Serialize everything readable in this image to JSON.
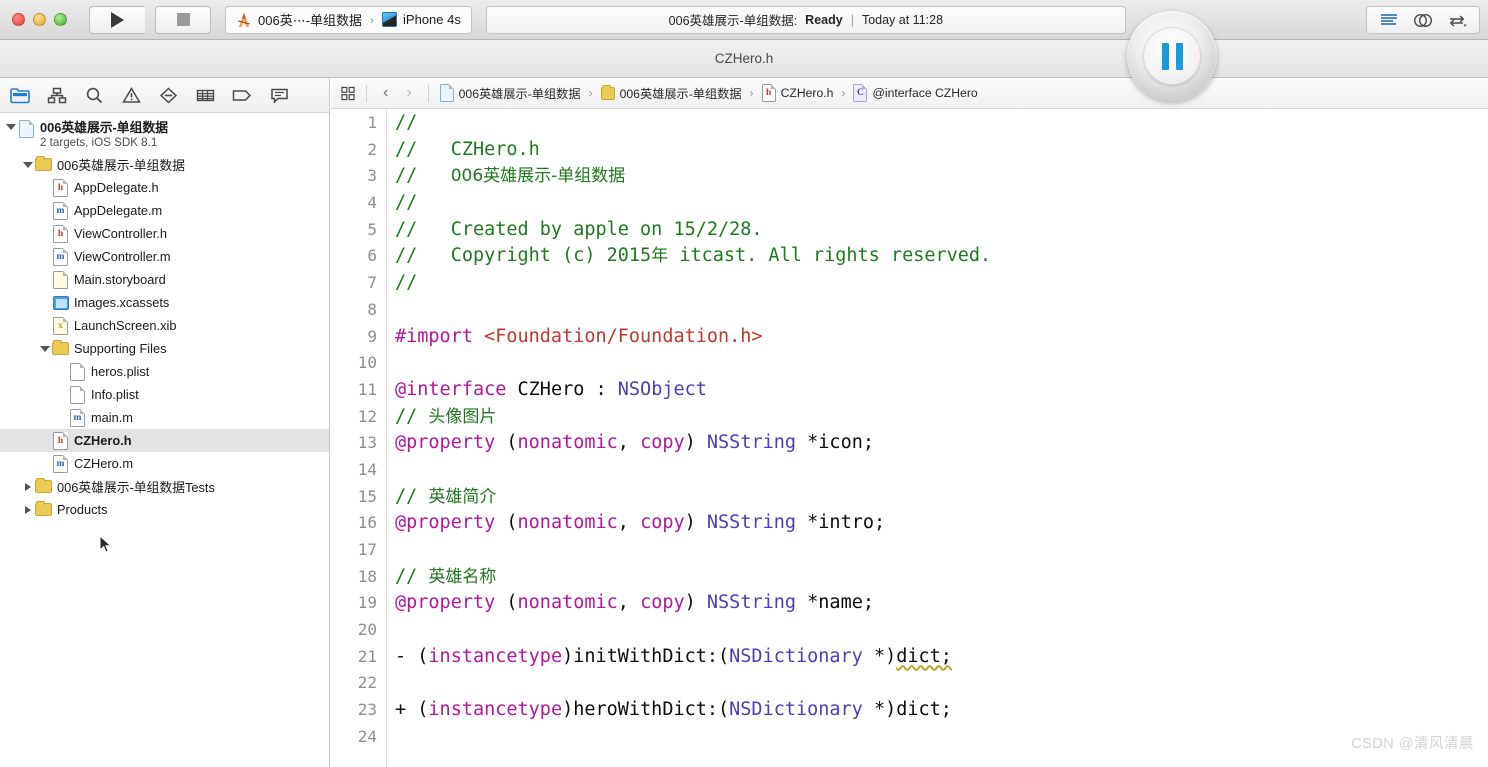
{
  "window": {
    "title": "CZHero.h"
  },
  "toolbar": {
    "run_label": "Run",
    "stop_label": "Stop",
    "scheme": {
      "project": "006英⋯-单组数据",
      "separator": "›",
      "destination": "iPhone 4s"
    },
    "status": {
      "target": "006英雄展示-单组数据:",
      "state": "Ready",
      "divider": "|",
      "time": "Today at 11:28"
    },
    "right_icons": [
      "editor-standard-icon",
      "editor-assistant-icon",
      "editor-version-icon"
    ]
  },
  "navigator": {
    "toolbar_icons": [
      "project-navigator-icon",
      "symbol-navigator-icon",
      "find-navigator-icon",
      "issue-navigator-icon",
      "test-navigator-icon",
      "debug-navigator-icon",
      "breakpoint-navigator-icon",
      "report-navigator-icon"
    ],
    "tree": [
      {
        "label": "006英雄展示-单组数据",
        "sub": "2 targets, iOS SDK 8.1",
        "icon": "project-file-icon",
        "indent": 0,
        "disclosure": "open",
        "type": "project",
        "selected": false
      },
      {
        "label": "006英雄展示-单组数据",
        "icon": "folder-icon",
        "indent": 1,
        "disclosure": "open",
        "type": "group",
        "selected": false
      },
      {
        "label": "AppDelegate.h",
        "icon": "header-file-icon",
        "indent": 2,
        "disclosure": "none",
        "type": "file",
        "selected": false
      },
      {
        "label": "AppDelegate.m",
        "icon": "source-file-icon",
        "indent": 2,
        "disclosure": "none",
        "type": "file",
        "selected": false
      },
      {
        "label": "ViewController.h",
        "icon": "header-file-icon",
        "indent": 2,
        "disclosure": "none",
        "type": "file",
        "selected": false
      },
      {
        "label": "ViewController.m",
        "icon": "source-file-icon",
        "indent": 2,
        "disclosure": "none",
        "type": "file",
        "selected": false
      },
      {
        "label": "Main.storyboard",
        "icon": "storyboard-file-icon",
        "indent": 2,
        "disclosure": "none",
        "type": "file",
        "selected": false
      },
      {
        "label": "Images.xcassets",
        "icon": "asset-catalog-icon",
        "indent": 2,
        "disclosure": "none",
        "type": "file",
        "selected": false
      },
      {
        "label": "LaunchScreen.xib",
        "icon": "xib-file-icon",
        "indent": 2,
        "disclosure": "none",
        "type": "file",
        "selected": false
      },
      {
        "label": "Supporting Files",
        "icon": "folder-icon",
        "indent": 2,
        "disclosure": "open",
        "type": "group",
        "selected": false
      },
      {
        "label": "heros.plist",
        "icon": "plist-file-icon",
        "indent": 3,
        "disclosure": "none",
        "type": "file",
        "selected": false
      },
      {
        "label": "Info.plist",
        "icon": "plist-file-icon",
        "indent": 3,
        "disclosure": "none",
        "type": "file",
        "selected": false
      },
      {
        "label": "main.m",
        "icon": "source-file-icon",
        "indent": 3,
        "disclosure": "none",
        "type": "file",
        "selected": false
      },
      {
        "label": "CZHero.h",
        "icon": "header-file-icon",
        "indent": 2,
        "disclosure": "none",
        "type": "file",
        "selected": true
      },
      {
        "label": "CZHero.m",
        "icon": "source-file-icon",
        "indent": 2,
        "disclosure": "none",
        "type": "file",
        "selected": false
      },
      {
        "label": "006英雄展示-单组数据Tests",
        "icon": "folder-icon",
        "indent": 1,
        "disclosure": "closed",
        "type": "group",
        "selected": false
      },
      {
        "label": "Products",
        "icon": "folder-icon",
        "indent": 1,
        "disclosure": "closed",
        "type": "group",
        "selected": false
      }
    ]
  },
  "editor": {
    "jumpbar": {
      "related_items_icon": "related-items-icon",
      "back_label": "‹",
      "forward_label": "›",
      "breadcrumbs": [
        {
          "label": "006英雄展示-单组数据",
          "icon": "project-file-icon"
        },
        {
          "label": "006英雄展示-单组数据",
          "icon": "folder-icon"
        },
        {
          "label": "CZHero.h",
          "icon": "header-file-icon"
        },
        {
          "label": "@interface CZHero",
          "icon": "class-symbol-icon"
        }
      ],
      "separator": "›"
    },
    "filename": "CZHero.h",
    "language": "objective-c",
    "first_line": 1,
    "lines": [
      {
        "n": 1,
        "tokens": [
          {
            "t": "//",
            "c": "cmt"
          }
        ]
      },
      {
        "n": 2,
        "tokens": [
          {
            "t": "//   CZHero.h",
            "c": "cmt"
          }
        ]
      },
      {
        "n": 3,
        "tokens": [
          {
            "t": "//   ",
            "c": "cmt"
          },
          {
            "t": "006英雄展示-单组数据",
            "c": "cmt cjk"
          }
        ]
      },
      {
        "n": 4,
        "tokens": [
          {
            "t": "//",
            "c": "cmt"
          }
        ]
      },
      {
        "n": 5,
        "tokens": [
          {
            "t": "//   Created by apple on 15/2/28.",
            "c": "cmt"
          }
        ]
      },
      {
        "n": 6,
        "tokens": [
          {
            "t": "//   Copyright (c) 2015",
            "c": "cmt"
          },
          {
            "t": "年",
            "c": "cmt cjk"
          },
          {
            "t": " itcast. All rights reserved.",
            "c": "cmt"
          }
        ]
      },
      {
        "n": 7,
        "tokens": [
          {
            "t": "//",
            "c": "cmt"
          }
        ]
      },
      {
        "n": 8,
        "tokens": []
      },
      {
        "n": 9,
        "tokens": [
          {
            "t": "#import ",
            "c": "kw"
          },
          {
            "t": "<Foundation/Foundation.h>",
            "c": "str"
          }
        ]
      },
      {
        "n": 10,
        "tokens": []
      },
      {
        "n": 11,
        "tokens": [
          {
            "t": "@interface",
            "c": "kw"
          },
          {
            "t": " CZHero : ",
            "c": "plain"
          },
          {
            "t": "NSObject",
            "c": "type"
          }
        ]
      },
      {
        "n": 12,
        "tokens": [
          {
            "t": "// ",
            "c": "cmt"
          },
          {
            "t": "头像图片",
            "c": "cmt cjk"
          }
        ]
      },
      {
        "n": 13,
        "tokens": [
          {
            "t": "@property",
            "c": "kw"
          },
          {
            "t": " (",
            "c": "plain"
          },
          {
            "t": "nonatomic",
            "c": "kw"
          },
          {
            "t": ", ",
            "c": "plain"
          },
          {
            "t": "copy",
            "c": "kw"
          },
          {
            "t": ") ",
            "c": "plain"
          },
          {
            "t": "NSString",
            "c": "type"
          },
          {
            "t": " *icon;",
            "c": "plain"
          }
        ]
      },
      {
        "n": 14,
        "tokens": []
      },
      {
        "n": 15,
        "tokens": [
          {
            "t": "// ",
            "c": "cmt"
          },
          {
            "t": "英雄简介",
            "c": "cmt cjk"
          }
        ]
      },
      {
        "n": 16,
        "tokens": [
          {
            "t": "@property",
            "c": "kw"
          },
          {
            "t": " (",
            "c": "plain"
          },
          {
            "t": "nonatomic",
            "c": "kw"
          },
          {
            "t": ", ",
            "c": "plain"
          },
          {
            "t": "copy",
            "c": "kw"
          },
          {
            "t": ") ",
            "c": "plain"
          },
          {
            "t": "NSString",
            "c": "type"
          },
          {
            "t": " *intro;",
            "c": "plain"
          }
        ]
      },
      {
        "n": 17,
        "tokens": []
      },
      {
        "n": 18,
        "tokens": [
          {
            "t": "// ",
            "c": "cmt"
          },
          {
            "t": "英雄名称",
            "c": "cmt cjk"
          }
        ]
      },
      {
        "n": 19,
        "tokens": [
          {
            "t": "@property",
            "c": "kw"
          },
          {
            "t": " (",
            "c": "plain"
          },
          {
            "t": "nonatomic",
            "c": "kw"
          },
          {
            "t": ", ",
            "c": "plain"
          },
          {
            "t": "copy",
            "c": "kw"
          },
          {
            "t": ") ",
            "c": "plain"
          },
          {
            "t": "NSString",
            "c": "type"
          },
          {
            "t": " *name;",
            "c": "plain"
          }
        ]
      },
      {
        "n": 20,
        "tokens": []
      },
      {
        "n": 21,
        "tokens": [
          {
            "t": "- (",
            "c": "plain"
          },
          {
            "t": "instancetype",
            "c": "kw"
          },
          {
            "t": ")initWithDict:(",
            "c": "plain"
          },
          {
            "t": "NSDictionary",
            "c": "type"
          },
          {
            "t": " *)",
            "c": "plain"
          },
          {
            "t": "dict;",
            "c": "plain squig"
          }
        ]
      },
      {
        "n": 22,
        "tokens": []
      },
      {
        "n": 23,
        "tokens": [
          {
            "t": "+ (",
            "c": "plain"
          },
          {
            "t": "instancetype",
            "c": "kw"
          },
          {
            "t": ")heroWithDict:(",
            "c": "plain"
          },
          {
            "t": "NSDictionary",
            "c": "type"
          },
          {
            "t": " *)dict;",
            "c": "plain"
          }
        ]
      },
      {
        "n": 24,
        "tokens": []
      }
    ]
  },
  "overlay": {
    "record_control": {
      "name": "pause-recording-button",
      "state": "playing",
      "accent": "#1a9ad6"
    }
  },
  "watermark": {
    "text": "CSDN @清风清晨"
  },
  "colors": {
    "comment": "#1f7a1f",
    "keyword": "#b3179b",
    "string": "#c0392b",
    "type": "#4b3fb8",
    "plain": "#0d0d0d",
    "selection": "#e3e3e3",
    "accent": "#1f7fd6"
  }
}
